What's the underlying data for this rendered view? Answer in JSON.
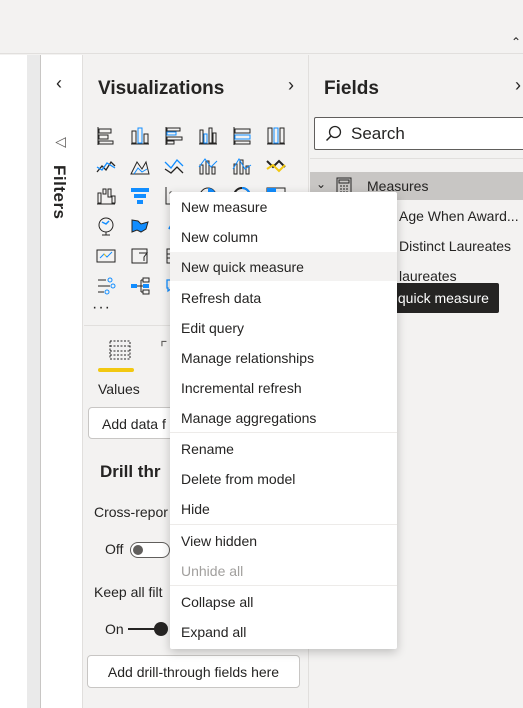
{
  "filters": {
    "label": "Filters",
    "collapse_icon": "chevron-left-icon",
    "funnel_icon": "funnel-icon"
  },
  "visualizations": {
    "title": "Visualizations",
    "icons": [
      "stacked-bar-icon",
      "stacked-column-icon",
      "clustered-bar-icon",
      "clustered-column-icon",
      "stacked-bar-100-icon",
      "stacked-column-100-icon",
      "line-chart-icon",
      "area-chart-icon",
      "stacked-area-icon",
      "line-column-icon",
      "line-stacked-column-icon",
      "ribbon-chart-icon",
      "waterfall-icon",
      "funnel-chart-icon",
      "scatter-chart-icon",
      "pie-chart-icon",
      "donut-chart-icon",
      "treemap-icon",
      "map-icon",
      "filled-map-icon",
      "shape-map-icon",
      "",
      "",
      "",
      "kpi-icon",
      "slicer-icon",
      "table-icon",
      "",
      "",
      "",
      "key-influencers-icon",
      "decomposition-tree-icon",
      "qa-icon",
      "",
      "",
      ""
    ],
    "more": "···",
    "values_label": "Values",
    "add_data_placeholder": "Add data f",
    "drill_title": "Drill thr",
    "cross_report_label": "Cross-repor",
    "off_label": "Off",
    "keep_filters_label": "Keep all filt",
    "on_label": "On",
    "drill_add_button": "Add drill-through fields here"
  },
  "fields": {
    "title": "Fields",
    "search_placeholder": "Search",
    "table_name": "Measures",
    "items": [
      "Age When Award...",
      "Distinct Laureates",
      "laureates"
    ]
  },
  "context_menu": {
    "items": [
      "New measure",
      "New column",
      "New quick measure",
      "Refresh data",
      "Edit query",
      "Manage relationships",
      "Incremental refresh",
      "Manage aggregations",
      "Rename",
      "Delete from model",
      "Hide",
      "View hidden",
      "Unhide all",
      "Collapse all",
      "Expand all"
    ]
  },
  "tooltip": "New quick measure",
  "colors": {
    "accent": "#f2c811",
    "tooltip_bg": "#252423",
    "pane_bg": "#f3f2f1"
  }
}
